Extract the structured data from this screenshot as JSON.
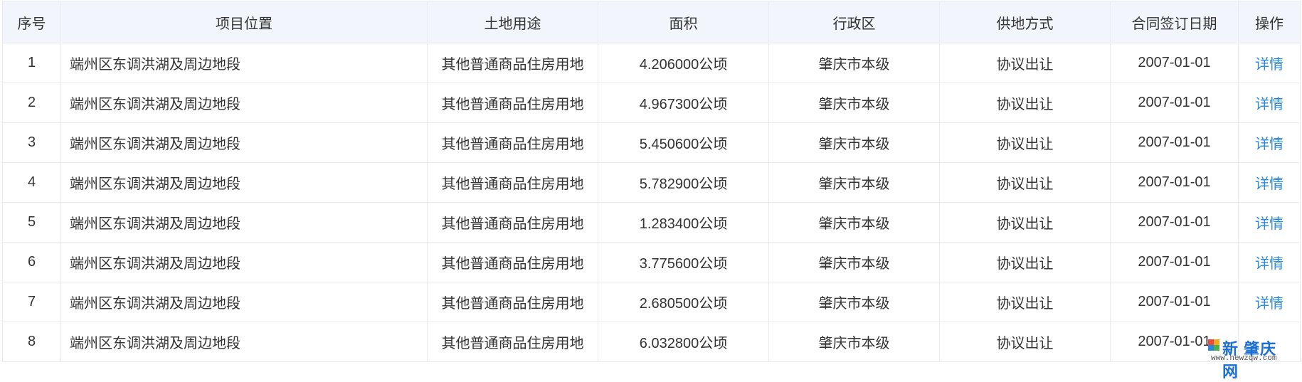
{
  "table": {
    "headers": [
      "序号",
      "项目位置",
      "土地用途",
      "面积",
      "行政区",
      "供地方式",
      "合同签订日期",
      "操作"
    ],
    "rows": [
      {
        "no": "1",
        "location": "端州区东调洪湖及周边地段",
        "use": "其他普通商品住房用地",
        "area": "4.206000公顷",
        "district": "肇庆市本级",
        "method": "协议出让",
        "date": "2007-01-01",
        "action": "详情"
      },
      {
        "no": "2",
        "location": "端州区东调洪湖及周边地段",
        "use": "其他普通商品住房用地",
        "area": "4.967300公顷",
        "district": "肇庆市本级",
        "method": "协议出让",
        "date": "2007-01-01",
        "action": "详情"
      },
      {
        "no": "3",
        "location": "端州区东调洪湖及周边地段",
        "use": "其他普通商品住房用地",
        "area": "5.450600公顷",
        "district": "肇庆市本级",
        "method": "协议出让",
        "date": "2007-01-01",
        "action": "详情"
      },
      {
        "no": "4",
        "location": "端州区东调洪湖及周边地段",
        "use": "其他普通商品住房用地",
        "area": "5.782900公顷",
        "district": "肇庆市本级",
        "method": "协议出让",
        "date": "2007-01-01",
        "action": "详情"
      },
      {
        "no": "5",
        "location": "端州区东调洪湖及周边地段",
        "use": "其他普通商品住房用地",
        "area": "1.283400公顷",
        "district": "肇庆市本级",
        "method": "协议出让",
        "date": "2007-01-01",
        "action": "详情"
      },
      {
        "no": "6",
        "location": "端州区东调洪湖及周边地段",
        "use": "其他普通商品住房用地",
        "area": "3.775600公顷",
        "district": "肇庆市本级",
        "method": "协议出让",
        "date": "2007-01-01",
        "action": "详情"
      },
      {
        "no": "7",
        "location": "端州区东调洪湖及周边地段",
        "use": "其他普通商品住房用地",
        "area": "2.680500公顷",
        "district": "肇庆市本级",
        "method": "协议出让",
        "date": "2007-01-01",
        "action": "详情"
      },
      {
        "no": "8",
        "location": "端州区东调洪湖及周边地段",
        "use": "其他普通商品住房用地",
        "area": "6.032800公顷",
        "district": "肇庆市本级",
        "method": "协议出让",
        "date": "2007-01-01",
        "action": ""
      }
    ]
  },
  "watermark": {
    "text": "新 肇庆网",
    "url": "www.newzqw.com"
  },
  "colors": {
    "header_bg": "#f2f6fc",
    "border": "#e8ecf1",
    "link": "#2b8ad8",
    "text": "#333333"
  }
}
